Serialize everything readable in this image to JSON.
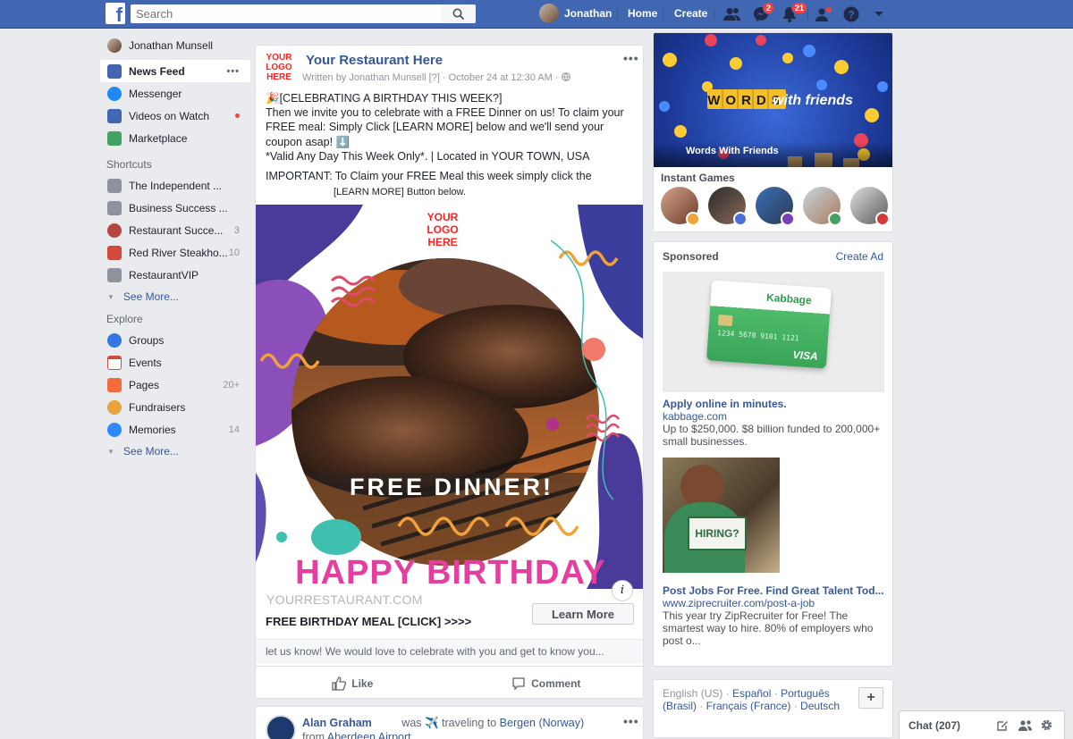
{
  "topbar": {
    "logo": "f",
    "search_placeholder": "Search",
    "user_name": "Jonathan",
    "home": "Home",
    "create": "Create",
    "messages_badge": "2",
    "notifications_badge": "21"
  },
  "left_nav": {
    "profile_name": "Jonathan Munsell",
    "main": [
      {
        "label": "News Feed"
      },
      {
        "label": "Messenger"
      },
      {
        "label": "Videos on Watch"
      },
      {
        "label": "Marketplace"
      }
    ],
    "shortcuts_header": "Shortcuts",
    "shortcuts": [
      {
        "label": "The Independent ...",
        "count": ""
      },
      {
        "label": "Business Success ...",
        "count": ""
      },
      {
        "label": "Restaurant Succe...",
        "count": "3"
      },
      {
        "label": "Red River Steakho...",
        "count": "10"
      },
      {
        "label": "RestaurantVIP",
        "count": ""
      }
    ],
    "see_more_1": "See More...",
    "explore_header": "Explore",
    "explore": [
      {
        "label": "Groups",
        "count": ""
      },
      {
        "label": "Events",
        "count": ""
      },
      {
        "label": "Pages",
        "count": "20+"
      },
      {
        "label": "Fundraisers",
        "count": ""
      },
      {
        "label": "Memories",
        "count": "14"
      }
    ],
    "see_more_2": "See More..."
  },
  "post": {
    "logo_text": "YOUR LOGO HERE",
    "page_name": "Your Restaurant Here",
    "meta": "Written by Jonathan Munsell [?] · October 24 at 12:30 AM · ",
    "lines": [
      "🎉[CELEBRATING A BIRTHDAY THIS WEEK?]",
      "Then we invite you to celebrate with a FREE Dinner on us! To claim your",
      "FREE meal: Simply Click  [LEARN MORE]  below and we'll send your",
      "coupon asap! ⬇️",
      "*Valid Any Day This Week Only*. | Located in YOUR TOWN, USA",
      "IMPORTANT: To Claim your FREE Meal this week simply click the"
    ],
    "line_center": "[LEARN MORE] Button below.",
    "image_logo": "YOUR LOGO HERE",
    "image_headline": "FREE DINNER!",
    "image_footer": "HAPPY BIRTHDAY",
    "domain": "YOURRESTAURANT.COM",
    "link_title": "FREE BIRTHDAY MEAL [CLICK] >>>>",
    "cta": "Learn More",
    "snippet": "let us know! We would love to celebrate with you and get to know you...",
    "like": "Like",
    "comment": "Comment"
  },
  "post2": {
    "author": "Alan Graham",
    "activity": "was ✈️ traveling to",
    "place": "Bergen (Norway)",
    "from_label": "from",
    "from_place": "Aberdeen Airport"
  },
  "games": {
    "banner_title_a": "WORDS",
    "banner_title_b": "with friends",
    "banner_caption": "Words With Friends",
    "section_title": "Instant Games"
  },
  "sponsored": {
    "header": "Sponsored",
    "create_ad": "Create Ad",
    "ad1": {
      "brand": "Kabbage",
      "card_number": "1234 5678 9101 1121",
      "card_brand": "VISA",
      "title": "Apply online in minutes.",
      "domain": "kabbage.com",
      "body": "Up to $250,000. $8 billion funded to 200,000+ small businesses."
    },
    "ad2": {
      "sign": "HIRING?",
      "title": "Post Jobs For Free. Find Great Talent Tod...",
      "domain": "www.ziprecruiter.com/post-a-job",
      "body": "This year try ZipRecruiter for Free! The smartest way to hire. 80% of employers who post o..."
    }
  },
  "languages": {
    "current": "English (US)",
    "l1": "Español",
    "l2": "Português (Brasil)",
    "l3": "Français (France)",
    "l4": "Deutsch",
    "plus": "+"
  },
  "chat": {
    "label": "Chat (207)"
  }
}
